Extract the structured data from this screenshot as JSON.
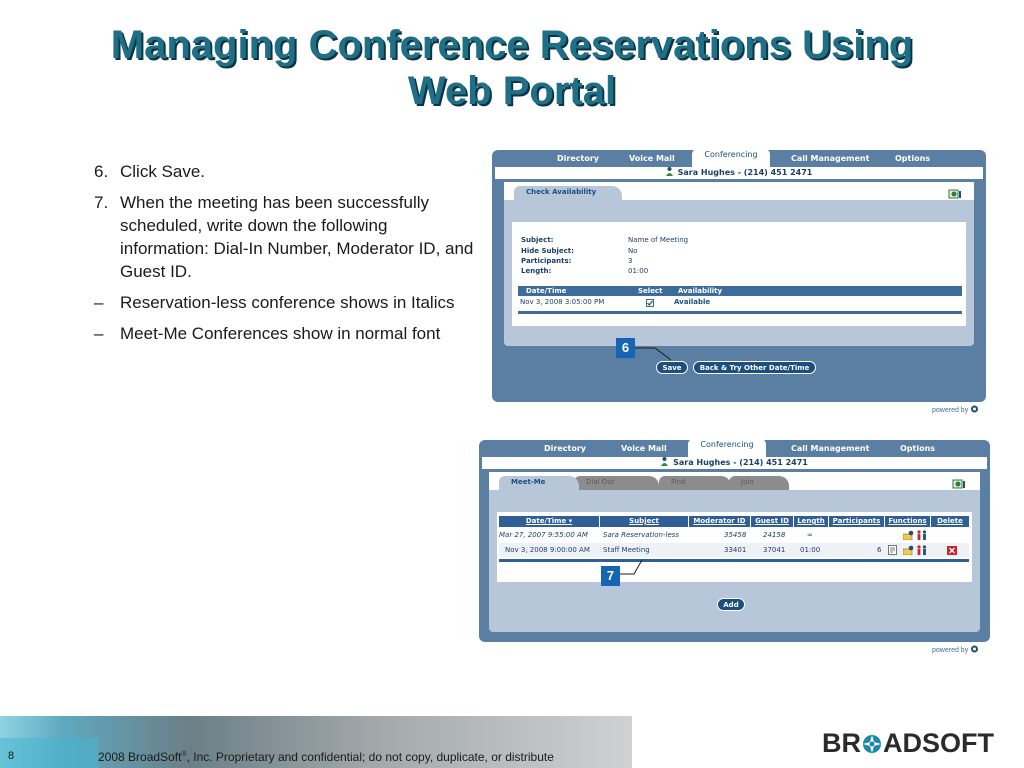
{
  "slide": {
    "title_line1": "Managing Conference Reservations Using",
    "title_line2": "Web Portal",
    "bullets": [
      {
        "marker": "6.",
        "text": "Click Save."
      },
      {
        "marker": "7.",
        "text": "When the meeting has been successfully scheduled, write down the following information: Dial-In Number, Moderator ID, and Guest ID."
      },
      {
        "marker": "–",
        "text": "Reservation-less conference shows in Italics"
      },
      {
        "marker": "–",
        "text": "Meet-Me Conferences show in normal font"
      }
    ],
    "page_number": "8",
    "footer_text_a": "2008 BroadSoft",
    "footer_reg": "®",
    "footer_text_b": ", Inc. Proprietary and confidential; do not copy, duplicate, or distribute",
    "logo_text_a": "BR",
    "logo_text_b": "ADSOFT"
  },
  "portal1": {
    "nav": {
      "directory": "Directory",
      "voice_mail": "Voice Mail",
      "conferencing": "Conferencing",
      "call_management": "Call Management",
      "options": "Options"
    },
    "user": "Sara Hughes - (214) 451 2471",
    "tab": "Check Availability",
    "fields": [
      {
        "label": "Subject:",
        "value": "Name of Meeting"
      },
      {
        "label": "Hide Subject:",
        "value": "No"
      },
      {
        "label": "Participants:",
        "value": "3"
      },
      {
        "label": "Length:",
        "value": "01:00"
      }
    ],
    "grid_headers": {
      "datetime": "Date/Time",
      "select": "Select",
      "availability": "Availability"
    },
    "grid_row": {
      "datetime": "Nov 3, 2008 3:05:00 PM",
      "selected": true,
      "availability": "Available"
    },
    "callout": "6",
    "save_label": "Save",
    "back_label": "Back & Try Other Date/Time",
    "powered_by": "powered by"
  },
  "portal2": {
    "nav": {
      "directory": "Directory",
      "voice_mail": "Voice Mail",
      "conferencing": "Conferencing",
      "call_management": "Call Management",
      "options": "Options"
    },
    "user": "Sara Hughes - (214) 451 2471",
    "tabs": [
      "Meet-Me",
      "Dial Out",
      "Find",
      "Join"
    ],
    "headers": [
      "Date/Time ▾",
      "Subject",
      "Moderator ID",
      "Guest ID",
      "Length",
      "Participants",
      "Functions",
      "Delete"
    ],
    "rows": [
      {
        "datetime": "Mar 27, 2007 9:55:00 AM",
        "subject": "Sara Reservation-less",
        "moderator_id": "35458",
        "guest_id": "24158",
        "length": "∞",
        "participants": "",
        "italic": true,
        "delete": false
      },
      {
        "datetime": "Nov 3, 2008 9:00:00 AM",
        "subject": "Staff Meeting",
        "moderator_id": "33401",
        "guest_id": "37041",
        "length": "01:00",
        "participants": "6",
        "italic": false,
        "delete": true
      }
    ],
    "callout": "7",
    "add_label": "Add",
    "powered_by": "powered by"
  }
}
